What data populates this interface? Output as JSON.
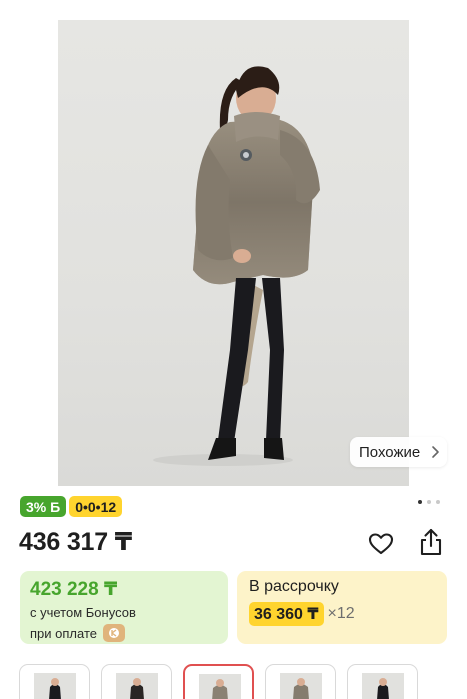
{
  "gallery": {
    "similar_label": "Похожие",
    "photo_count": 3,
    "active_photo": 1
  },
  "badges": {
    "bonus": "3% Б",
    "installment": "0•0•12"
  },
  "product": {
    "price": "436 317 ₸"
  },
  "bonus_card": {
    "price": "423 228 ₸",
    "line1": "с учетом Бонусов",
    "line2": "при оплате"
  },
  "installment_card": {
    "title": "В рассрочку",
    "amount": "36 360 ₸",
    "multiplier": "×12"
  },
  "thumbnails": {
    "count": 5,
    "selected_index": 2
  },
  "colors": {
    "green": "#47a52d",
    "yellow": "#ffd42e",
    "green_bg": "#e3f5d2",
    "yellow_bg": "#fdf3c9",
    "selected_border": "#e05050"
  }
}
